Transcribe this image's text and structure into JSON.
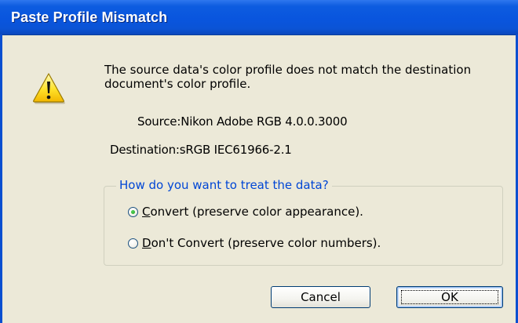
{
  "dialog": {
    "title": "Paste Profile Mismatch",
    "message": "The source data's color profile does not match the destination document's color profile.",
    "source_label": "Source:",
    "source_value": "Nikon Adobe RGB 4.0.0.3000",
    "destination_label": "Destination:",
    "destination_value": "sRGB IEC61966-2.1",
    "icon": "warning-icon"
  },
  "group": {
    "legend": "How do you want to treat the data?",
    "options": [
      {
        "mnemonic": "C",
        "rest": "onvert (preserve color appearance).",
        "selected": true
      },
      {
        "mnemonic": "D",
        "rest": "on't Convert (preserve color numbers).",
        "selected": false
      }
    ]
  },
  "buttons": {
    "cancel": "Cancel",
    "ok": "OK"
  },
  "colors": {
    "titlebar": "#0955de",
    "dialog_bg": "#ece9d8",
    "legend_text": "#0046d5"
  }
}
